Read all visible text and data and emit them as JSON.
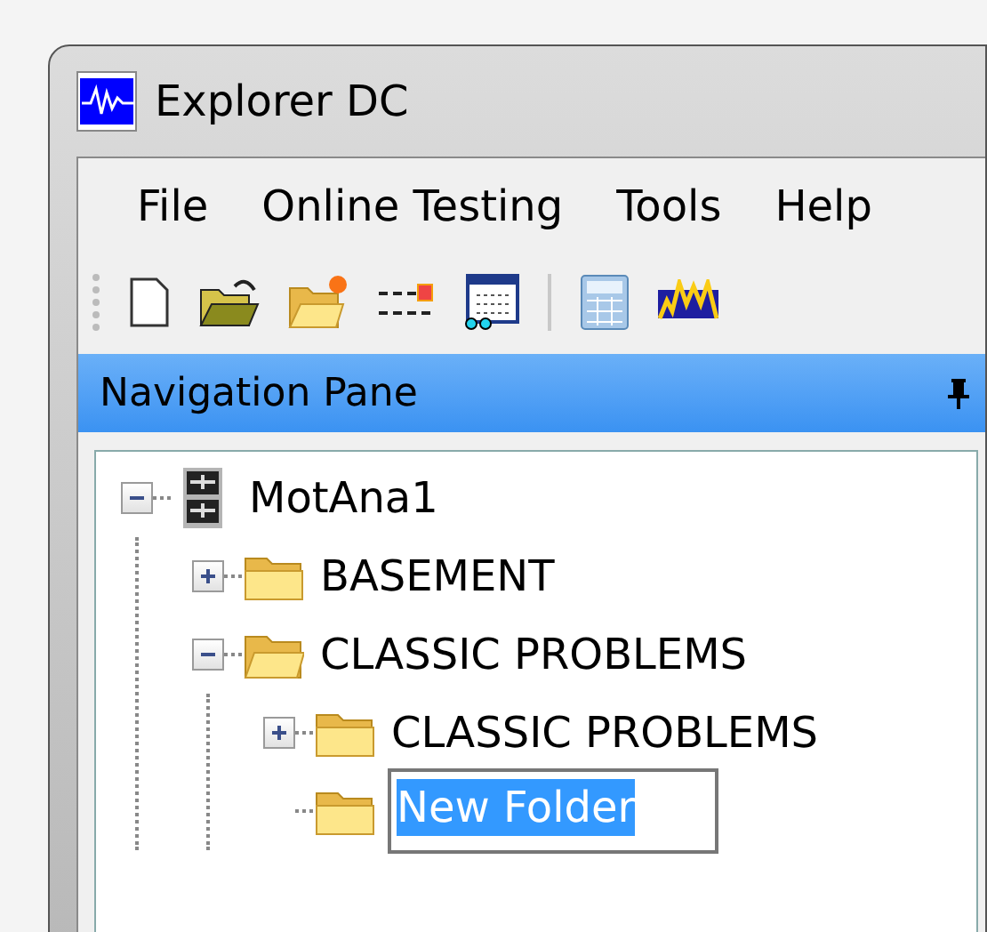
{
  "window": {
    "title": "Explorer DC"
  },
  "menu": [
    "File",
    "Online Testing",
    "Tools",
    "Help"
  ],
  "toolbar": [
    {
      "kind": "new"
    },
    {
      "kind": "open"
    },
    {
      "kind": "new-folder"
    },
    {
      "kind": "lines"
    },
    {
      "kind": "report"
    },
    {
      "kind": "separator"
    },
    {
      "kind": "calculator"
    },
    {
      "kind": "wave"
    }
  ],
  "pane": {
    "title": "Navigation Pane"
  },
  "tree": [
    {
      "label": "MotAna1",
      "kind": "root",
      "expanded": true,
      "editing": false,
      "children": [
        {
          "label": "BASEMENT",
          "kind": "folder",
          "expanded": false,
          "editing": false
        },
        {
          "label": "CLASSIC PROBLEMS",
          "kind": "folder",
          "expanded": true,
          "editing": false,
          "children": [
            {
              "label": "CLASSIC PROBLEMS",
              "kind": "folder",
              "expanded": false,
              "editing": false
            },
            {
              "label": "New Folder",
              "kind": "folder",
              "editing": true
            }
          ]
        }
      ]
    }
  ]
}
